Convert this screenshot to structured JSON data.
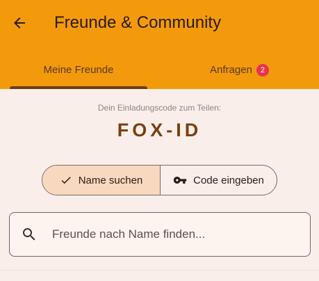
{
  "appbar": {
    "title": "Freunde & Community",
    "back_icon": "arrow-left-icon"
  },
  "tabs": [
    {
      "label": "Meine Freunde",
      "selected": true
    },
    {
      "label": "Anfragen",
      "badge": "2",
      "selected": false
    }
  ],
  "invite": {
    "label": "Dein Einladungscode zum Teilen:",
    "code": "FOX-ID"
  },
  "mode": {
    "options": [
      {
        "label": "Name suchen",
        "icon": "check-icon",
        "selected": true
      },
      {
        "label": "Code eingeben",
        "icon": "key-icon",
        "selected": false
      }
    ]
  },
  "search": {
    "placeholder": "Freunde nach Name finden...",
    "value": "",
    "icon": "search-icon"
  },
  "colors": {
    "appbar": "#f39a0c",
    "background": "#f9eee9",
    "tab_indicator": "#6b3f14",
    "badge": "#e8334d",
    "invite_code": "#7a3f12",
    "segment_selected": "#f8d8bf"
  }
}
